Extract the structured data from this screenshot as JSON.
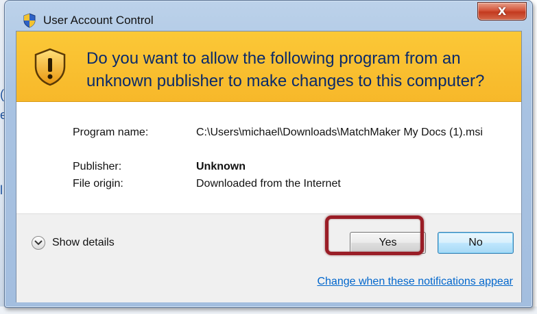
{
  "window": {
    "title": "User Account Control",
    "close_symbol": "X"
  },
  "banner": {
    "question": "Do you want to allow the following program from an unknown publisher to make changes to this computer?"
  },
  "details": {
    "program_name_label": "Program name:",
    "program_name_value": "C:\\Users\\michael\\Downloads\\MatchMaker My Docs (1).msi",
    "publisher_label": "Publisher:",
    "publisher_value": "Unknown",
    "file_origin_label": "File origin:",
    "file_origin_value": "Downloaded from the Internet"
  },
  "footer": {
    "show_details_label": "Show details",
    "yes_label": "Yes",
    "no_label": "No",
    "change_link_label": "Change when these notifications appear"
  },
  "icons": {
    "title": "uac-shield-icon",
    "banner": "warning-shield-icon",
    "toggle": "chevron-down-icon",
    "close": "close-icon"
  },
  "colors": {
    "banner_bg": "#f7b82a",
    "banner_text": "#0a2a6a",
    "highlight": "#9a1d26",
    "link": "#0066cc",
    "close_button": "#c33a1f"
  }
}
